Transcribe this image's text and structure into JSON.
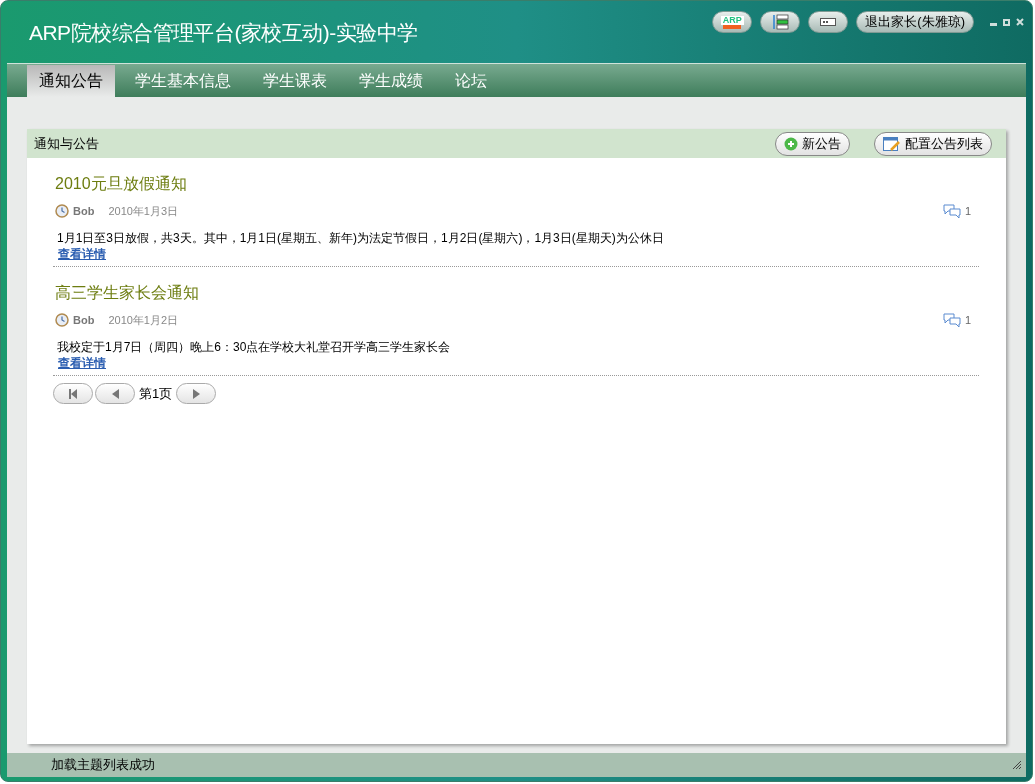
{
  "window": {
    "title": "ARP院校综合管理平台(家校互动)-实验中学",
    "logo_text": "ARP",
    "logout_button": "退出家长(朱雅琼)"
  },
  "tabs": [
    {
      "label": "通知公告",
      "selected": true
    },
    {
      "label": "学生基本信息",
      "selected": false
    },
    {
      "label": "学生课表",
      "selected": false
    },
    {
      "label": "学生成绩",
      "selected": false
    },
    {
      "label": "论坛",
      "selected": false
    }
  ],
  "panel": {
    "title": "通知与公告",
    "buttons": [
      {
        "kind": "add",
        "label": "新公告"
      },
      {
        "kind": "config",
        "label": "配置公告列表"
      }
    ],
    "notices": [
      {
        "title": "2010元旦放假通知",
        "author": "Bob",
        "date": "2010年1月3日",
        "comments": "1",
        "body": "1月1日至3日放假，共3天。其中，1月1日(星期五、新年)为法定节假日，1月2日(星期六)，1月3日(星期天)为公休日",
        "link": "查看详情"
      },
      {
        "title": "高三学生家长会通知",
        "author": "Bob",
        "date": "2010年1月2日",
        "comments": "1",
        "body": "我校定于1月7日（周四）晚上6：30点在学校大礼堂召开学高三学生家长会",
        "link": "查看详情"
      }
    ],
    "pager": {
      "page_label": "第1页"
    }
  },
  "status_bar": "加载主题列表成功"
}
